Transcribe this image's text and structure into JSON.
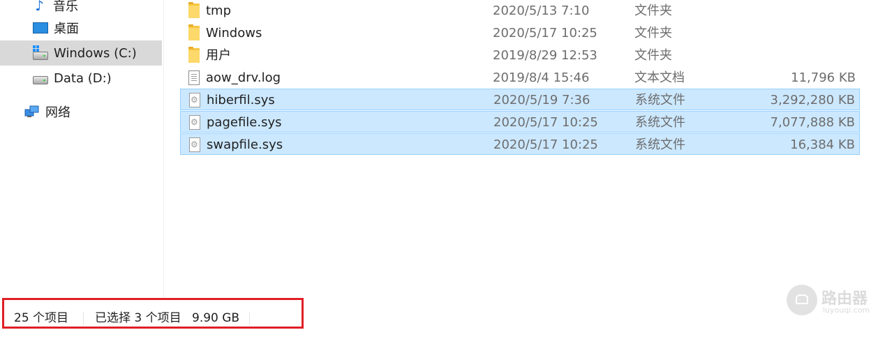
{
  "nav": {
    "items": [
      {
        "label": "音乐",
        "icon": "music-icon",
        "selected": false
      },
      {
        "label": "桌面",
        "icon": "desktop-icon",
        "selected": false
      },
      {
        "label": "Windows (C:)",
        "icon": "windows-drive-icon",
        "selected": true
      },
      {
        "label": "Data (D:)",
        "icon": "drive-icon",
        "selected": false
      },
      {
        "label": "网络",
        "icon": "network-icon",
        "selected": false
      }
    ]
  },
  "files": {
    "rows": [
      {
        "name": "tmp",
        "date": "2020/5/13 7:10",
        "type": "文件夹",
        "size": "",
        "icon": "folder-icon",
        "selected": false
      },
      {
        "name": "Windows",
        "date": "2020/5/17 10:25",
        "type": "文件夹",
        "size": "",
        "icon": "folder-icon",
        "selected": false
      },
      {
        "name": "用户",
        "date": "2019/8/29 12:53",
        "type": "文件夹",
        "size": "",
        "icon": "folder-icon",
        "selected": false
      },
      {
        "name": "aow_drv.log",
        "date": "2019/8/4 15:46",
        "type": "文本文档",
        "size": "11,796 KB",
        "icon": "text-file-icon",
        "selected": false
      },
      {
        "name": "hiberfil.sys",
        "date": "2020/5/19 7:36",
        "type": "系统文件",
        "size": "3,292,280 KB",
        "icon": "system-file-icon",
        "selected": true
      },
      {
        "name": "pagefile.sys",
        "date": "2020/5/17 10:25",
        "type": "系统文件",
        "size": "7,077,888 KB",
        "icon": "system-file-icon",
        "selected": true
      },
      {
        "name": "swapfile.sys",
        "date": "2020/5/17 10:25",
        "type": "系统文件",
        "size": "16,384 KB",
        "icon": "system-file-icon",
        "selected": true
      }
    ]
  },
  "status": {
    "item_count": "25 个项目",
    "selected_count": "已选择 3 个项目",
    "selected_size": "9.90 GB",
    "highlight_color": "#e01f26"
  },
  "watermark": {
    "text": "路由器",
    "sub": "luyouqi.com"
  },
  "colors": {
    "selection_bg": "#cce8ff",
    "selection_border": "#99d1ff",
    "nav_selected_bg": "#d9d9d9"
  }
}
